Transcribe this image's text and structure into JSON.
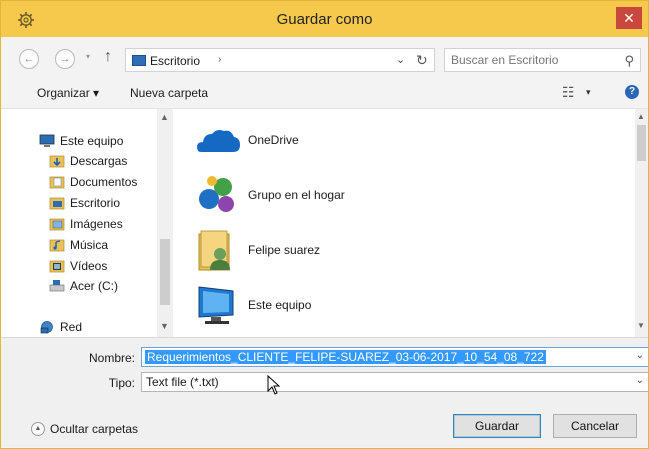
{
  "window": {
    "title": "Guardar como",
    "close_glyph": "✕",
    "title_icon": "gear-icon"
  },
  "nav": {
    "back_glyph": "←",
    "forward_glyph": "→",
    "recent_glyph": "▾",
    "up_glyph": "↑",
    "address_text": "Escritorio",
    "address_sep": "›",
    "address_drop": "⌄",
    "refresh_glyph": "↻",
    "search_placeholder": "Buscar en Escritorio",
    "search_glyph": "⚲"
  },
  "toolbar": {
    "organize_label": "Organizar ▾",
    "new_folder_label": "Nueva carpeta",
    "view_glyph": "☷",
    "view_drop": "▾",
    "help_glyph": "?"
  },
  "sidebar": {
    "items": [
      {
        "label": "Este equipo",
        "icon": "computer-icon"
      },
      {
        "label": "Descargas",
        "icon": "downloads-folder-icon"
      },
      {
        "label": "Documentos",
        "icon": "documents-folder-icon"
      },
      {
        "label": "Escritorio",
        "icon": "desktop-folder-icon"
      },
      {
        "label": "Imágenes",
        "icon": "pictures-folder-icon"
      },
      {
        "label": "Música",
        "icon": "music-folder-icon"
      },
      {
        "label": "Vídeos",
        "icon": "videos-folder-icon"
      },
      {
        "label": "Acer (C:)",
        "icon": "drive-icon"
      },
      {
        "label": "Red",
        "icon": "network-icon"
      }
    ]
  },
  "files": {
    "items": [
      {
        "label": "OneDrive",
        "icon": "onedrive-icon"
      },
      {
        "label": "Grupo en el hogar",
        "icon": "homegroup-icon"
      },
      {
        "label": "Felipe suarez",
        "icon": "user-folder-icon"
      },
      {
        "label": "Este equipo",
        "icon": "computer-icon"
      }
    ]
  },
  "form": {
    "name_label": "Nombre:",
    "name_value": "Requerimientos_CLIENTE_FELIPE-SUAREZ_03-06-2017_10_54_08_722",
    "type_label": "Tipo:",
    "type_value": "Text file (*.txt)",
    "hide_folders_label": "Ocultar carpetas",
    "save_label": "Guardar",
    "cancel_label": "Cancelar"
  },
  "colors": {
    "titlebar": "#f6c94d",
    "close": "#c9473c",
    "selection": "#3399ff"
  }
}
